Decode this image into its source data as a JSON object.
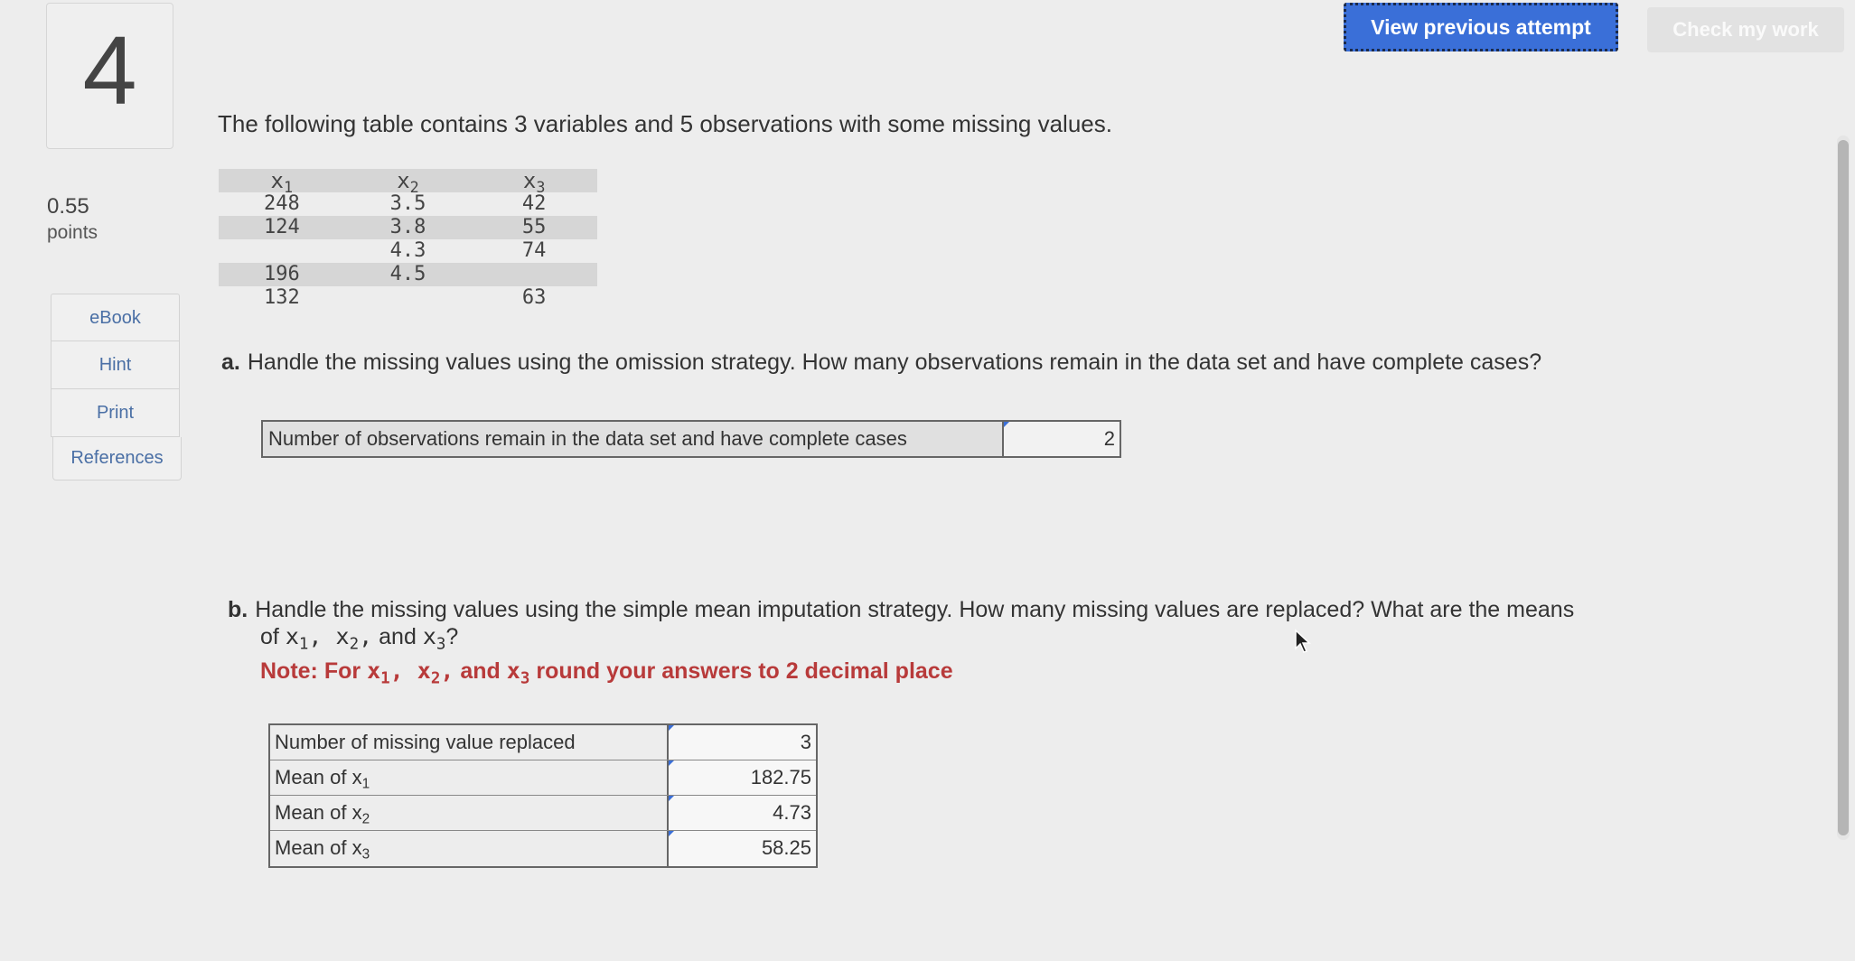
{
  "question": {
    "number": "4",
    "points_value": "0.55",
    "points_label": "points"
  },
  "side_nav": {
    "ebook": "eBook",
    "hint": "Hint",
    "print": "Print",
    "references": "References"
  },
  "toolbar": {
    "view_previous": "View previous attempt",
    "check_work": "Check my work"
  },
  "intro_text": "The following table contains 3 variables and 5 observations with some missing values.",
  "data_table": {
    "headers": [
      "x",
      "x",
      "x"
    ],
    "header_subs": [
      "1",
      "2",
      "3"
    ],
    "rows": [
      [
        "248",
        "3.5",
        "42"
      ],
      [
        "124",
        "3.8",
        "55"
      ],
      [
        "",
        "4.3",
        "74"
      ],
      [
        "196",
        "4.5",
        ""
      ],
      [
        "132",
        "",
        "63"
      ]
    ]
  },
  "part_a": {
    "letter": "a.",
    "question": "Handle the missing values using the omission strategy. How many observations remain in the data set and have complete cases?",
    "row_label": "Number of observations remain in the data set and have complete cases",
    "row_value": "2"
  },
  "part_b": {
    "letter": "b.",
    "question": "Handle the missing values using the simple mean imputation strategy. How many missing values are replaced? What are the means",
    "question_cont_of": "of",
    "question_cont_and": "and",
    "note_prefix": "Note: For",
    "note_suffix": "round your answers to 2 decimal place",
    "rows": [
      {
        "label": "Number of missing value replaced",
        "sub": "",
        "value": "3"
      },
      {
        "label": "Mean of x",
        "sub": "1",
        "value": "182.75"
      },
      {
        "label": "Mean of x",
        "sub": "2",
        "value": "4.73"
      },
      {
        "label": "Mean of x",
        "sub": "3",
        "value": "58.25"
      }
    ]
  },
  "colors": {
    "accent": "#3a6fd8",
    "note": "#b83a3a"
  }
}
